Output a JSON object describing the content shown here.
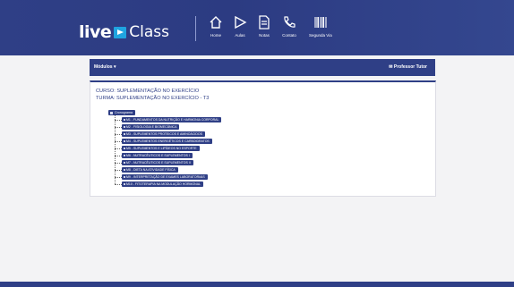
{
  "brand": {
    "live": "live",
    "class": "Class"
  },
  "nav": [
    {
      "label": "Home",
      "icon": "home-icon"
    },
    {
      "label": "Aulas",
      "icon": "play-icon"
    },
    {
      "label": "Notas",
      "icon": "document-icon"
    },
    {
      "label": "Contato",
      "icon": "phone-icon"
    },
    {
      "label": "Segunda Via",
      "icon": "barcode-icon"
    }
  ],
  "subbar": {
    "modules": "Módulos ▾",
    "tutor": "✉ Professor Tutor"
  },
  "course": {
    "curso_label": "CURSO:",
    "curso_value": "SUPLEMENTAÇÃO NO EXERCÍCIO",
    "turma_label": "TURMA:",
    "turma_value": "SUPLEMENTAÇÃO NO EXERCÍCIO - T3"
  },
  "tree": {
    "root": "Cronograma",
    "modules": [
      "M1 - FUNDAMENTOS DA NUTRIÇÃO E HARMONIA CORPORAL",
      "M2 - FISIOLOGIA E BIOMECÂNICA",
      "M3 - SUPLEMENTOS PROTEICOS E AMINOÁCIDOS",
      "M4 - SUPLEMENTOS ENERGÉTICOS E CARBOIDRATOS",
      "M5 - SUPLEMENTOS E LIPÍDEOS NO ESPORTE",
      "M6 - NUTRACÊUTICOS E SUPLEMENTOS I",
      "M7 - NUTRACÊUTICOS E SUPLEMENTOS II",
      "M8 - DIETA NA ATIVIDADE FÍSICA",
      "M9 - INTERPRETAÇÃO DE EXAMES LABORATORIAIS",
      "M10 - FITOTERAPIA NA MODULAÇÃO HORMONAL"
    ]
  },
  "colors": {
    "primary": "#2f3f86",
    "accent": "#1fa4e0",
    "background": "#f3f3f5"
  }
}
